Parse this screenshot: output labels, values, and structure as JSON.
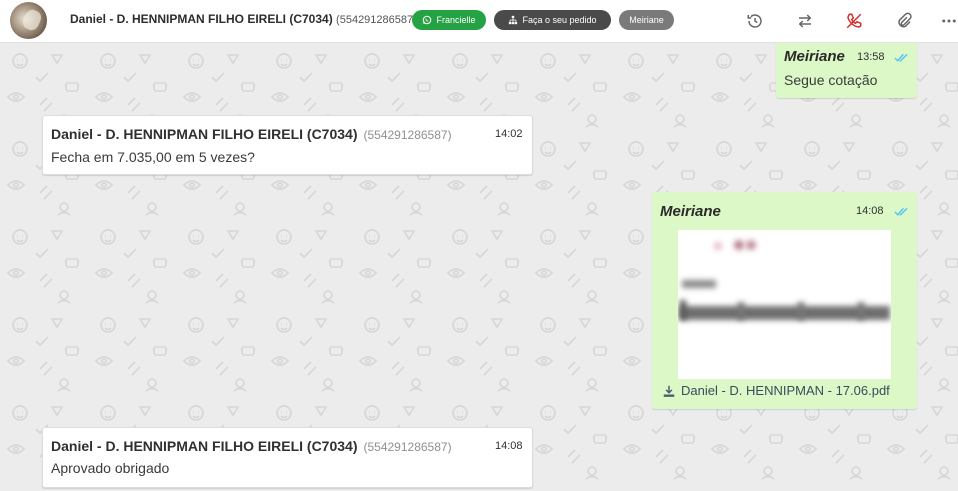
{
  "header": {
    "contact_name": "Daniel - D. HENNIPMAN FILHO EIRELI (C7034)",
    "contact_phone": "(554291286587)",
    "tags": {
      "whatsapp_user": "Francielle",
      "order": "Faça o seu pedido",
      "agent": "Meiriane"
    },
    "icons": [
      "history-icon",
      "transfer-icon",
      "end-call-icon",
      "attachment-icon",
      "more-icon"
    ]
  },
  "messages": [
    {
      "direction": "out",
      "sender": "Meiriane",
      "time": "13:58",
      "text": "Segue cotação",
      "status": "read"
    },
    {
      "direction": "in",
      "sender": "Daniel - D. HENNIPMAN FILHO EIRELI (C7034)",
      "phone": "(554291286587)",
      "time": "14:02",
      "text": "Fecha em 7.035,00 em 5 vezes?"
    },
    {
      "direction": "out",
      "sender": "Meiriane",
      "time": "14:08",
      "attachment": "Daniel - D. HENNIPMAN - 17.06.pdf",
      "status": "read"
    },
    {
      "direction": "in",
      "sender": "Daniel - D. HENNIPMAN FILHO EIRELI (C7034)",
      "phone": "(554291286587)",
      "time": "14:08",
      "text": "Aprovado obrigado"
    }
  ],
  "colors": {
    "incoming_bubble": "#ffffff",
    "outgoing_bubble": "#dcf8c6",
    "read_ticks": "#4fc3f7",
    "whatsapp_tag": "#25a244",
    "end_call": "#d32f2f",
    "background": "#ececec"
  }
}
